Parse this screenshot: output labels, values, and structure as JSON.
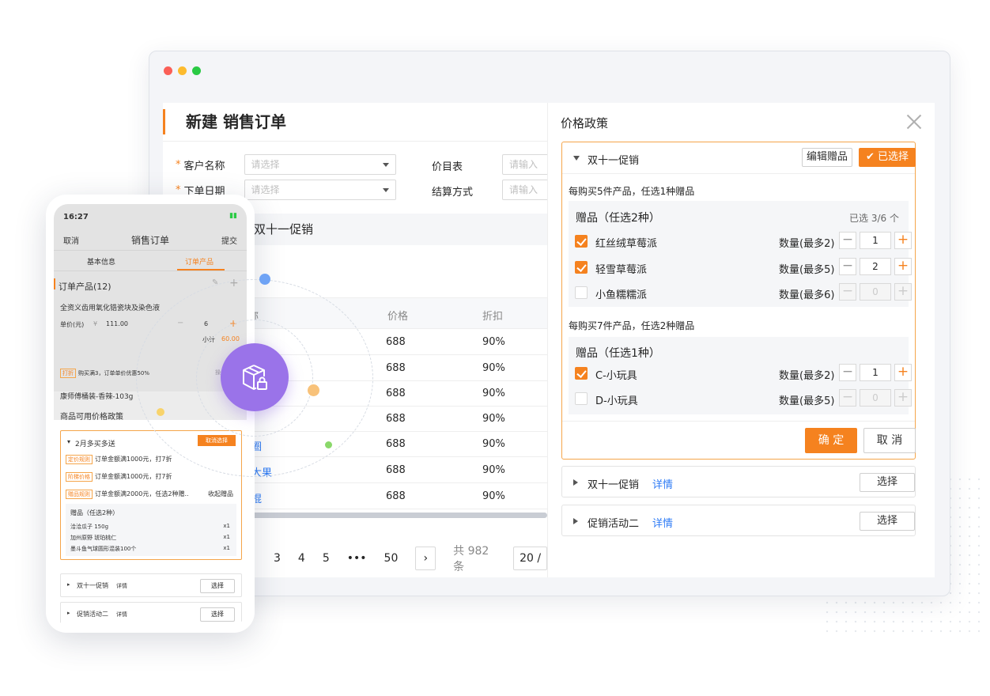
{
  "browser": {
    "dots": [
      "#fb5f57",
      "#fdbb2e",
      "#2aca44"
    ]
  },
  "order": {
    "title": "新建 销售订单",
    "customer_label": "客户名称",
    "customer_placeholder": "请选择",
    "date_label": "下单日期",
    "date_placeholder": "请选择",
    "pricelist_label": "价目表",
    "pricelist_placeholder": "请输入",
    "settle_label": "结算方式",
    "settle_placeholder": "请输入",
    "promo_band": "后双十一促销",
    "columns": {
      "name": "称",
      "price": "价格",
      "discount": "折扣"
    },
    "rows": [
      {
        "name": "",
        "price": "688",
        "discount": "90%"
      },
      {
        "name": "",
        "price": "688",
        "discount": "90%"
      },
      {
        "name": "",
        "price": "688",
        "discount": "90%"
      },
      {
        "name": "",
        "price": "688",
        "discount": "90%"
      },
      {
        "name": "圈",
        "price": "688",
        "discount": "90%"
      },
      {
        "name": "大果",
        "price": "688",
        "discount": "90%"
      },
      {
        "name": "棍",
        "price": "688",
        "discount": "90%"
      }
    ],
    "pager": {
      "p3": "3",
      "p4": "4",
      "p5": "5",
      "ellipsis": "•••",
      "p50": "50",
      "next": "›",
      "total": "共 982 条",
      "size": "20 /"
    }
  },
  "panel": {
    "title": "价格政策",
    "active": {
      "name": "双十一促销",
      "edit_gift": "编辑赠品",
      "selected": "已选择",
      "rule1": "每购买5件产品，任选1种赠品",
      "group1": {
        "title": "赠品（任选2种）",
        "selected_count": "已选 3/6 个",
        "items": [
          {
            "name": "红丝绒草莓派",
            "qty_label": "数量(最多2)",
            "qty": "1",
            "checked": true
          },
          {
            "name": "轻雪草莓派",
            "qty_label": "数量(最多5)",
            "qty": "2",
            "checked": true
          },
          {
            "name": "小鱼糯糯派",
            "qty_label": "数量(最多6)",
            "qty": "0",
            "checked": false
          }
        ]
      },
      "rule2": "每购买7件产品，任选2种赠品",
      "group2": {
        "title": "赠品（任选1种）",
        "items": [
          {
            "name": "C-小玩具",
            "qty_label": "数量(最多2)",
            "qty": "1",
            "checked": true
          },
          {
            "name": "D-小玩具",
            "qty_label": "数量(最多5)",
            "qty": "0",
            "checked": false
          }
        ]
      },
      "confirm": "确 定",
      "cancel": "取 消"
    },
    "others": [
      {
        "name": "双十一促销",
        "detail": "详情",
        "action": "选择"
      },
      {
        "name": "促销活动二",
        "detail": "详情",
        "action": "选择"
      }
    ]
  },
  "phone": {
    "time": "16:27",
    "status_icons": "signal-wifi-battery",
    "cancel": "取消",
    "title": "销售订单",
    "submit": "提交",
    "tab_basic": "基本信息",
    "tab_products": "订单产品",
    "section": "订单产品(12)",
    "product1": "全资义齿用氧化锆瓷块及染色液",
    "price_label": "单价(元)",
    "price_symbol": "¥",
    "price_value": "111.00",
    "qty": "6",
    "subtotal_label": "小计",
    "subtotal_value": "60.00",
    "promo_tag": "打折",
    "promo_text": "购买满3，订单单价优惠50%",
    "promo_op": "操作",
    "product2": "康师傅桶装-香辣-103g",
    "policy_title": "商品可用价格政策",
    "card": {
      "name": "2月多买多送",
      "cancel_btn": "取消选择",
      "lines": [
        {
          "tag": "定价规则",
          "text": "订单金额满1000元，打7折"
        },
        {
          "tag": "阶梯价格",
          "text": "订单金额满1000元，打7折"
        },
        {
          "tag": "赠品规则",
          "text": "订单金额满2000元，任选2种赠..",
          "extra": "收起赠品"
        }
      ],
      "gift_title": "赠品（任选2种）",
      "gifts": [
        {
          "name": "洽洽瓜子 150g",
          "qty": "x1"
        },
        {
          "name": "加州原野 琥珀桃仁",
          "qty": "x1"
        },
        {
          "name": "墨斗鱼气球圆形混装100个",
          "qty": "x1"
        }
      ]
    },
    "others": [
      {
        "name": "双十一促销",
        "detail": "详情",
        "action": "选择"
      },
      {
        "name": "促销活动二",
        "detail": "详情",
        "action": "选择"
      }
    ]
  },
  "center_icon": "package-lock-icon",
  "colors": {
    "accent": "#f5821f",
    "link": "#2f7cf6",
    "purple": "#9a73e9"
  }
}
